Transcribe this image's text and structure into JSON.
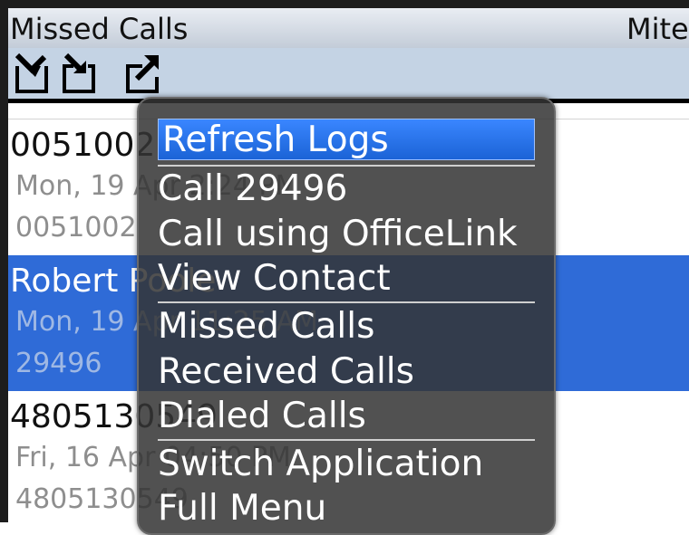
{
  "header": {
    "title": "Missed Calls",
    "right_text": "Mite"
  },
  "toolbar": {
    "icons": [
      "missed-calls-icon",
      "received-calls-icon",
      "dialed-calls-icon"
    ]
  },
  "call_log": [
    {
      "line1": "0051002",
      "line2": "Mon, 19 Apr 2:24 PM",
      "line3": "0051002"
    },
    {
      "line1": "Robert Poole",
      "line2": "Mon, 19 Apr 11:25 AM",
      "line3": "29496"
    },
    {
      "line1": "4805130549",
      "line2": "Fri, 16 Apr 04:50 PM",
      "line3": "4805130549"
    }
  ],
  "menu": {
    "items": [
      "Refresh Logs",
      "Call 29496",
      "Call using OfficeLink",
      "View Contact",
      "Missed Calls",
      "Received Calls",
      "Dialed Calls",
      "Switch Application",
      "Full Menu"
    ],
    "highlighted_index": 0
  },
  "colors": {
    "selection": "#2f6bd7",
    "menu_background": "#343434",
    "menu_highlight": "#2a76ef"
  }
}
